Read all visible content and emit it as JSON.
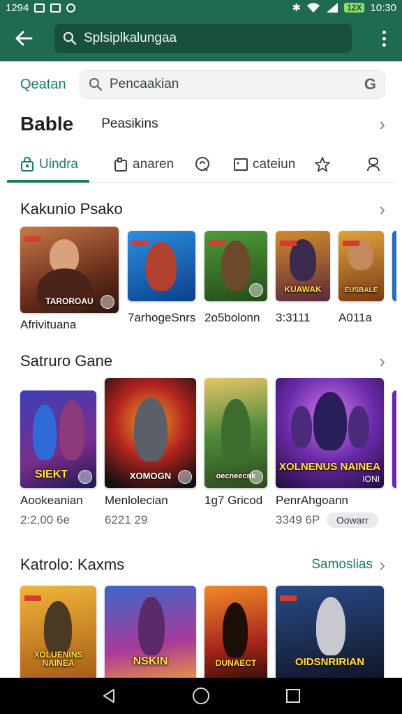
{
  "status_bar": {
    "time_left": "1294",
    "time_right": "10:30",
    "battery_label": "12X"
  },
  "app_bar": {
    "search_text": "Splsiplkalungaa"
  },
  "search": {
    "label": "Qeatan",
    "placeholder": "Pencaakian"
  },
  "store_header": {
    "title": "Bable",
    "subtitle": "Peasikins"
  },
  "tabs": [
    {
      "label": "Uindra",
      "icon": "bag-icon",
      "active": true
    },
    {
      "label": "anaren",
      "icon": "clipboard-icon",
      "active": false
    },
    {
      "label": "",
      "icon": "chat-icon",
      "active": false
    },
    {
      "label": "cateiun",
      "icon": "card-icon",
      "active": false
    },
    {
      "label": "",
      "icon": "star-icon",
      "active": false
    },
    {
      "label": "",
      "icon": "person-icon",
      "active": false
    }
  ],
  "sections": [
    {
      "title": "Kakunio Psako",
      "link": "",
      "games": [
        {
          "name": "Afrivituana",
          "subtitle": "",
          "caption": "TAROROAU"
        },
        {
          "name": "7arhogeSnrs",
          "subtitle": "",
          "caption": ""
        },
        {
          "name": "2o5bolonn",
          "subtitle": "",
          "caption": ""
        },
        {
          "name": "3:3111",
          "subtitle": "",
          "caption": "KUAWAK"
        },
        {
          "name": "A011a",
          "subtitle": "",
          "caption": "EUSBALE"
        }
      ]
    },
    {
      "title": "Satruro Gane",
      "link": "",
      "games": [
        {
          "name": "Aookeanian",
          "subtitle": "2:2,00 6e",
          "caption": "SIEKT"
        },
        {
          "name": "Menlolecian",
          "subtitle": "6221 29",
          "caption": "XOMOGN"
        },
        {
          "name": "1g7 Gricod",
          "subtitle": "",
          "caption": "oecneecnk"
        },
        {
          "name": "PenrAhgoann",
          "subtitle": "3349 6P",
          "caption": "XOLNENUS NAINEA",
          "button": "Oowarr",
          "tag": "IONI"
        }
      ]
    },
    {
      "title": "Katrolo: Kaxms",
      "link": "Samoslias",
      "games": [
        {
          "name": "",
          "subtitle": "",
          "caption": "XOLUENINS NAINEA"
        },
        {
          "name": "",
          "subtitle": "",
          "caption": "NSKIN"
        },
        {
          "name": "",
          "subtitle": "",
          "caption": "DUNAECT"
        },
        {
          "name": "",
          "subtitle": "",
          "caption": "OIDSNRIRIAN"
        }
      ]
    }
  ]
}
